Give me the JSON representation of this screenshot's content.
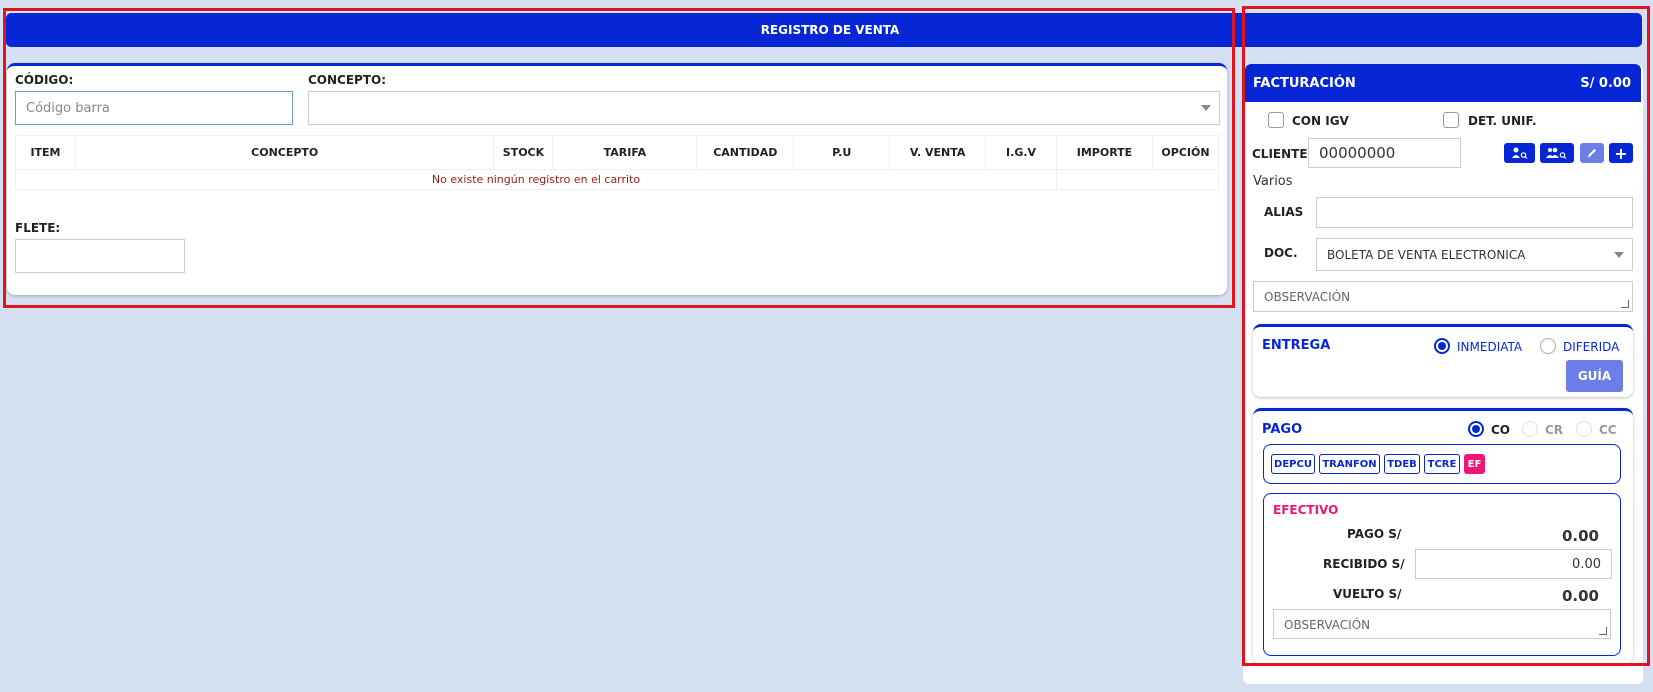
{
  "header": {
    "title": "REGISTRO DE VENTA"
  },
  "left": {
    "codigo_label": "CÓDIGO:",
    "codigo_placeholder": "Código barra",
    "concepto_label": "CONCEPTO:",
    "table_headers": [
      "ITEM",
      "CONCEPTO",
      "STOCK",
      "TARIFA",
      "CANTIDAD",
      "P.U",
      "V. VENTA",
      "I.G.V",
      "IMPORTE",
      "OPCIÓN"
    ],
    "empty_message": "No existe ningún registro en el carrito",
    "flete_label": "FLETE:"
  },
  "facturacion": {
    "title": "FACTURACIÓN",
    "total": "S/ 0.00",
    "con_igv_label": "CON IGV",
    "det_unif_label": "DET. UNIF.",
    "cliente_label": "CLIENTE",
    "cliente_value": "00000000",
    "cliente_name": "Varios",
    "alias_label": "ALIAS",
    "doc_label": "DOC.",
    "doc_value": "BOLETA DE VENTA ELECTRONICA",
    "observacion_placeholder": "OBSERVACIÓN"
  },
  "entrega": {
    "title": "ENTREGA",
    "option_inmediata": "INMEDIATA",
    "option_diferida": "DIFERIDA",
    "selected": "INMEDIATA",
    "guia_button": "GUÍA"
  },
  "pago": {
    "title": "PAGO",
    "options": [
      "CO",
      "CR",
      "CC"
    ],
    "selected": "CO",
    "methods": [
      "DEPCU",
      "TRANFON",
      "TDEB",
      "TCRE",
      "EF"
    ],
    "active_method": "EF",
    "efectivo": {
      "title": "EFECTIVO",
      "pago_label": "PAGO S/",
      "pago_value": "0.00",
      "recibido_label": "RECIBIDO S/",
      "recibido_value": "0.00",
      "vuelto_label": "VUELTO S/",
      "vuelto_value": "0.00",
      "observacion_placeholder": "OBSERVACIÓN"
    }
  },
  "colors": {
    "primary": "#0727d6",
    "accent_pink": "#ec1777",
    "background": "#d5e1f3",
    "highlight_red": "#e2141d",
    "error_text": "#9b1b1b"
  }
}
